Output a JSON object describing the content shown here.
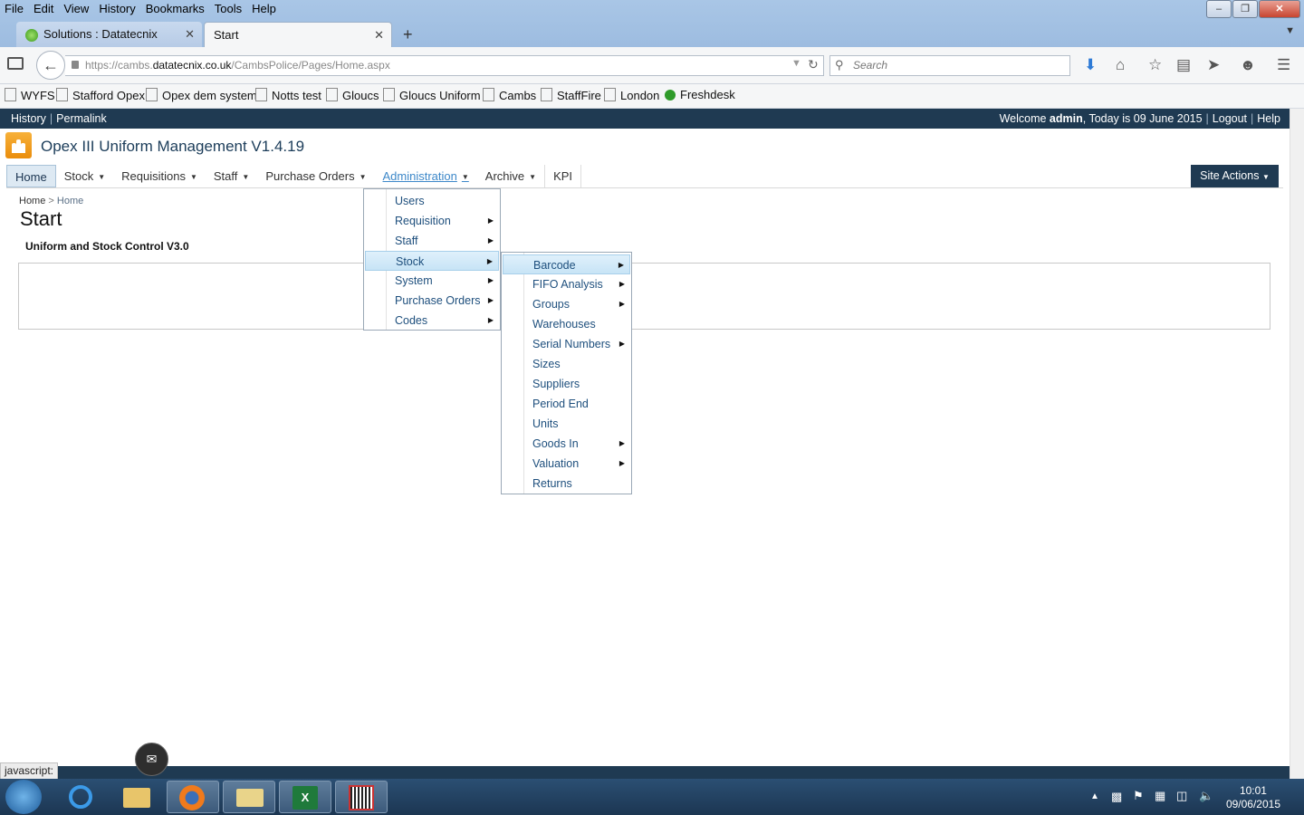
{
  "menubar": [
    "File",
    "Edit",
    "View",
    "History",
    "Bookmarks",
    "Tools",
    "Help"
  ],
  "tabs": [
    {
      "label": "Solutions : Datatecnix"
    },
    {
      "label": "Start"
    }
  ],
  "url": {
    "prefix": "https://cambs.",
    "host": "datatecnix.co.uk",
    "path": "/CambsPolice/Pages/Home.aspx"
  },
  "search": {
    "placeholder": "Search"
  },
  "bookmarks": [
    "WYFS",
    "Stafford Opex",
    "Opex dem system",
    "Notts test",
    "Gloucs",
    "Gloucs Uniform",
    "Cambs",
    "StaffFire",
    "London",
    "Freshdesk"
  ],
  "topbar": {
    "history": "History",
    "permalink": "Permalink",
    "welcome_prefix": "Welcome ",
    "user": "admin",
    "today_text": ", Today is 09 June 2015",
    "logout": "Logout",
    "help": "Help"
  },
  "app": {
    "title": "Opex III Uniform Management V1.4.19"
  },
  "nav": {
    "items": [
      "Home",
      "Stock",
      "Requisitions",
      "Staff",
      "Purchase Orders",
      "Administration",
      "Archive",
      "KPI"
    ],
    "site_actions": "Site Actions"
  },
  "breadcrumb": {
    "root": "Home",
    "current": "Home"
  },
  "page": {
    "title": "Start",
    "subtitle": "Uniform and Stock Control V3.0"
  },
  "admin_menu": [
    {
      "label": "Users",
      "submenu": false
    },
    {
      "label": "Requisition",
      "submenu": true
    },
    {
      "label": "Staff",
      "submenu": true
    },
    {
      "label": "Stock",
      "submenu": true,
      "highlighted": true
    },
    {
      "label": "System",
      "submenu": true
    },
    {
      "label": "Purchase Orders",
      "submenu": true
    },
    {
      "label": "Codes",
      "submenu": true
    }
  ],
  "stock_menu": [
    {
      "label": "Barcode",
      "submenu": true,
      "highlighted": true
    },
    {
      "label": "FIFO Analysis",
      "submenu": true
    },
    {
      "label": "Groups",
      "submenu": true
    },
    {
      "label": "Warehouses",
      "submenu": false
    },
    {
      "label": "Serial Numbers",
      "submenu": true
    },
    {
      "label": "Sizes",
      "submenu": false
    },
    {
      "label": "Suppliers",
      "submenu": false
    },
    {
      "label": "Period End",
      "submenu": false
    },
    {
      "label": "Units",
      "submenu": false
    },
    {
      "label": "Goods In",
      "submenu": true
    },
    {
      "label": "Valuation",
      "submenu": true
    },
    {
      "label": "Returns",
      "submenu": false
    }
  ],
  "status": {
    "text": "javascript:"
  },
  "clock": {
    "time": "10:01",
    "date": "09/06/2015"
  }
}
